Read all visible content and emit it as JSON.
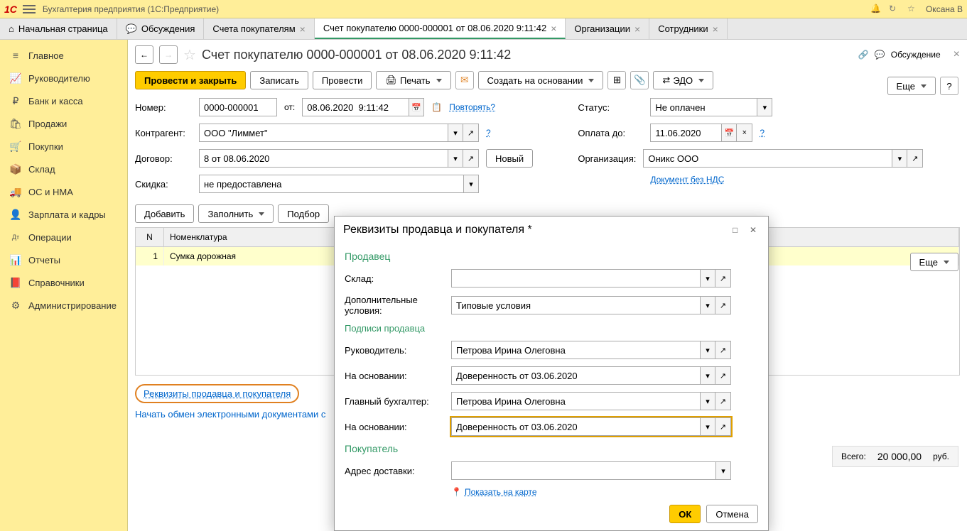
{
  "topbar": {
    "app_title": "Бухгалтерия предприятия  (1С:Предприятие)",
    "user": "Оксана В"
  },
  "tabs": [
    {
      "label": "Начальная страница",
      "icon": "home",
      "closable": false
    },
    {
      "label": "Обсуждения",
      "icon": "chat",
      "closable": false
    },
    {
      "label": "Счета покупателям",
      "closable": true
    },
    {
      "label": "Счет покупателю 0000-000001 от 08.06.2020 9:11:42",
      "closable": true,
      "active": true
    },
    {
      "label": "Организации",
      "closable": true
    },
    {
      "label": "Сотрудники",
      "closable": true
    }
  ],
  "sidebar": [
    {
      "label": "Главное",
      "icon": "≡"
    },
    {
      "label": "Руководителю",
      "icon": "📈"
    },
    {
      "label": "Банк и касса",
      "icon": "₽"
    },
    {
      "label": "Продажи",
      "icon": "🛍"
    },
    {
      "label": "Покупки",
      "icon": "🛒"
    },
    {
      "label": "Склад",
      "icon": "📦"
    },
    {
      "label": "ОС и НМА",
      "icon": "🚚"
    },
    {
      "label": "Зарплата и кадры",
      "icon": "👤"
    },
    {
      "label": "Операции",
      "icon": "Дт"
    },
    {
      "label": "Отчеты",
      "icon": "📊"
    },
    {
      "label": "Справочники",
      "icon": "📕"
    },
    {
      "label": "Администрирование",
      "icon": "⚙"
    }
  ],
  "doc": {
    "title": "Счет покупателю 0000-000001 от 08.06.2020 9:11:42",
    "discussion": "Обсуждение"
  },
  "toolbar": {
    "post_close": "Провести и закрыть",
    "save": "Записать",
    "post": "Провести",
    "print": "Печать",
    "create_based": "Создать на основании",
    "edo": "ЭДО",
    "more": "Еще"
  },
  "form": {
    "number_label": "Номер:",
    "number": "0000-000001",
    "from_label": "от:",
    "date": "08.06.2020  9:11:42",
    "repeat": "Повторять?",
    "counterparty_label": "Контрагент:",
    "counterparty": "ООО \"Лиммет\"",
    "contract_label": "Договор:",
    "contract": "8 от 08.06.2020",
    "new_btn": "Новый",
    "discount_label": "Скидка:",
    "discount": "не предоставлена",
    "status_label": "Статус:",
    "status": "Не оплачен",
    "pay_until_label": "Оплата до:",
    "pay_until": "11.06.2020",
    "org_label": "Организация:",
    "org": "Оникс ООО",
    "no_vat": "Документ без НДС"
  },
  "table_toolbar": {
    "add": "Добавить",
    "fill": "Заполнить",
    "pick": "Подбор"
  },
  "table": {
    "head_n": "N",
    "head_name": "Номенклатура",
    "rows": [
      {
        "n": "1",
        "name": "Сумка дорожная"
      }
    ]
  },
  "req_link": "Реквизиты продавца и покупателя",
  "bottom_text": "Начать обмен электронными документами с",
  "totals": {
    "label": "Всего:",
    "amount": "20 000,00",
    "currency": "руб."
  },
  "modal": {
    "title": "Реквизиты продавца и покупателя *",
    "seller": "Продавец",
    "warehouse_label": "Склад:",
    "warehouse": "",
    "extra_label": "Дополнительные условия:",
    "extra": "Типовые условия",
    "signatures": "Подписи продавца",
    "head_label": "Руководитель:",
    "head": "Петрова Ирина Олеговна",
    "basis1_label": "На основании:",
    "basis1": "Доверенность от 03.06.2020",
    "accountant_label": "Главный бухгалтер:",
    "accountant": "Петрова Ирина Олеговна",
    "basis2_label": "На основании:",
    "basis2": "Доверенность от 03.06.2020",
    "buyer": "Покупатель",
    "delivery_label": "Адрес доставки:",
    "delivery": "",
    "map_link": "Показать на карте",
    "ok": "ОК",
    "cancel": "Отмена"
  }
}
